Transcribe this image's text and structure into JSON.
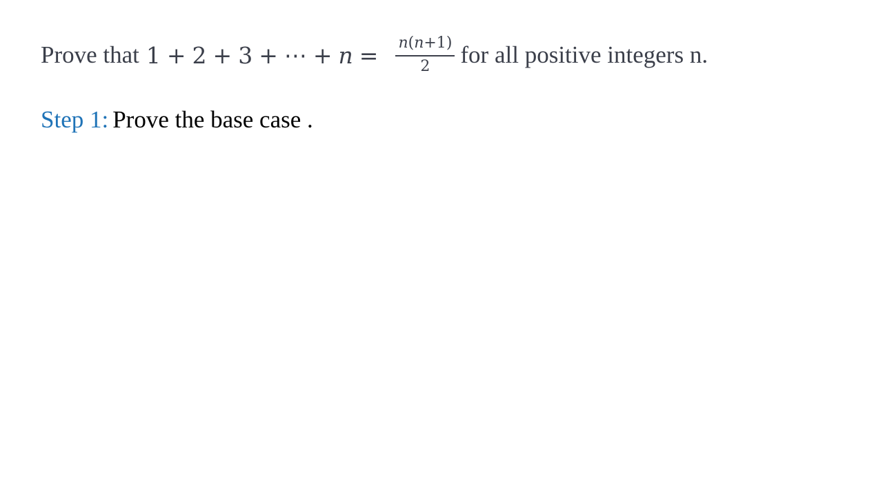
{
  "problem": {
    "prefix": "Prove that",
    "lhs": {
      "t1": "1",
      "plus1": "+",
      "t2": "2",
      "plus2": "+",
      "t3": "3",
      "plus3": "+",
      "dots": "⋯",
      "plus4": "+",
      "tn": "n",
      "equals": "="
    },
    "fraction": {
      "numerator_n": "n",
      "numerator_open": "(",
      "numerator_inner": "n",
      "numerator_plus": "+1",
      "numerator_close": ")",
      "denominator": "2"
    },
    "suffix": "for all positive  integers n."
  },
  "step": {
    "label": "Step 1:",
    "text": "Prove the base case ."
  },
  "colors": {
    "body_text": "#3b3f4a",
    "step_label": "#1f73b7",
    "step_text": "#000000"
  }
}
